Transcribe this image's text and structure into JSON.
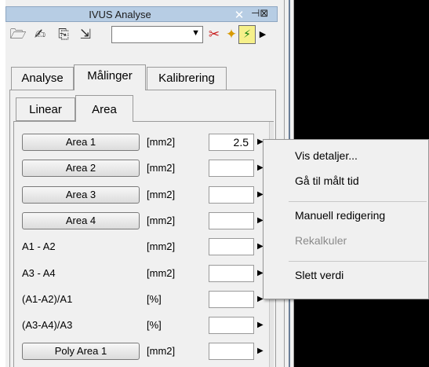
{
  "window": {
    "title": "IVUS Analyse",
    "close_glyph": "✕",
    "pin_glyph": "⊣⊠"
  },
  "toolbar": {
    "icons": [
      {
        "name": "open-folder-icon",
        "glyph": "🗁",
        "color": "#2b2b2b"
      },
      {
        "name": "edit-document-icon",
        "glyph": "✍",
        "color": "#2b2b2b"
      },
      {
        "name": "export-document-icon",
        "glyph": "⎘",
        "color": "#2b2b2b"
      },
      {
        "name": "save-exit-icon",
        "glyph": "⇲",
        "color": "#2b2b2b"
      },
      {
        "name": "measure-tool-icon",
        "glyph": "✂",
        "color": "#c81e1e"
      },
      {
        "name": "plugin-icon",
        "glyph": "✦",
        "color": "#d89a00"
      },
      {
        "name": "auto-detect-icon",
        "glyph": "⚡",
        "color": "#0a7a0a"
      },
      {
        "name": "more-icon",
        "glyph": "▶",
        "color": "#000000"
      }
    ],
    "combo_value": "",
    "combo_arrow": "▼"
  },
  "tabs_main": [
    {
      "label": "Analyse",
      "active": false
    },
    {
      "label": "Målinger",
      "active": true
    },
    {
      "label": "Kalibrering",
      "active": false
    }
  ],
  "tabs_sub": [
    {
      "label": "Linear",
      "active": false
    },
    {
      "label": "Area",
      "active": true
    }
  ],
  "rows": [
    {
      "label": "Area 1",
      "kind": "button",
      "unit": "[mm2]",
      "value": "2.5"
    },
    {
      "label": "Area 2",
      "kind": "button",
      "unit": "[mm2]",
      "value": ""
    },
    {
      "label": "Area 3",
      "kind": "button",
      "unit": "[mm2]",
      "value": ""
    },
    {
      "label": "Area 4",
      "kind": "button",
      "unit": "[mm2]",
      "value": ""
    },
    {
      "label": "A1 - A2",
      "kind": "text",
      "unit": "[mm2]",
      "value": ""
    },
    {
      "label": "A3 - A4",
      "kind": "text",
      "unit": "[mm2]",
      "value": ""
    },
    {
      "label": "(A1-A2)/A1",
      "kind": "text",
      "unit": "[%]",
      "value": ""
    },
    {
      "label": "(A3-A4)/A3",
      "kind": "text",
      "unit": "[%]",
      "value": ""
    },
    {
      "label": "Poly Area 1",
      "kind": "button",
      "unit": "[mm2]",
      "value": ""
    }
  ],
  "row_arrow": "▶",
  "context_menu": [
    {
      "label": "Vis detaljer...",
      "enabled": true
    },
    {
      "label": "Gå til målt tid",
      "enabled": true
    },
    {
      "separator": true
    },
    {
      "label": "Manuell redigering",
      "enabled": true
    },
    {
      "label": "Rekalkuler",
      "enabled": false
    },
    {
      "separator": true
    },
    {
      "label": "Slett verdi",
      "enabled": true
    }
  ],
  "colors": {
    "titlebar": "#b7cde4",
    "disabled_text": "#8a8a8a",
    "panel": "#f0f0f0"
  }
}
